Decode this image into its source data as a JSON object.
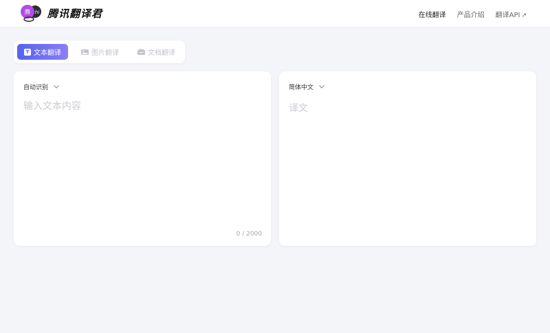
{
  "header": {
    "logo_badge_left": "腾",
    "logo_badge_right": "hi",
    "app_name": "腾讯翻译君",
    "nav": [
      {
        "label": "在线翻译"
      },
      {
        "label": "产品介绍"
      },
      {
        "label": "翻译API",
        "icon": "arrow-up-right-icon"
      }
    ]
  },
  "modes": [
    {
      "label": "文本翻译",
      "icon": "text-icon",
      "active": true
    },
    {
      "label": "图片翻译",
      "icon": "image-icon",
      "active": false
    },
    {
      "label": "文档翻译",
      "icon": "document-icon",
      "active": false
    }
  ],
  "source": {
    "language": "自动识别",
    "placeholder": "输入文本内容",
    "value": "",
    "char_count": "0 / 2000"
  },
  "target": {
    "language": "简体中文",
    "placeholder": "译文"
  },
  "colors": {
    "accent_start": "#5663f0",
    "accent_end": "#8a7ef5",
    "logo_purple": "#b14be6",
    "page_bg": "#f4f5f9",
    "placeholder": "#c8cbd1"
  }
}
